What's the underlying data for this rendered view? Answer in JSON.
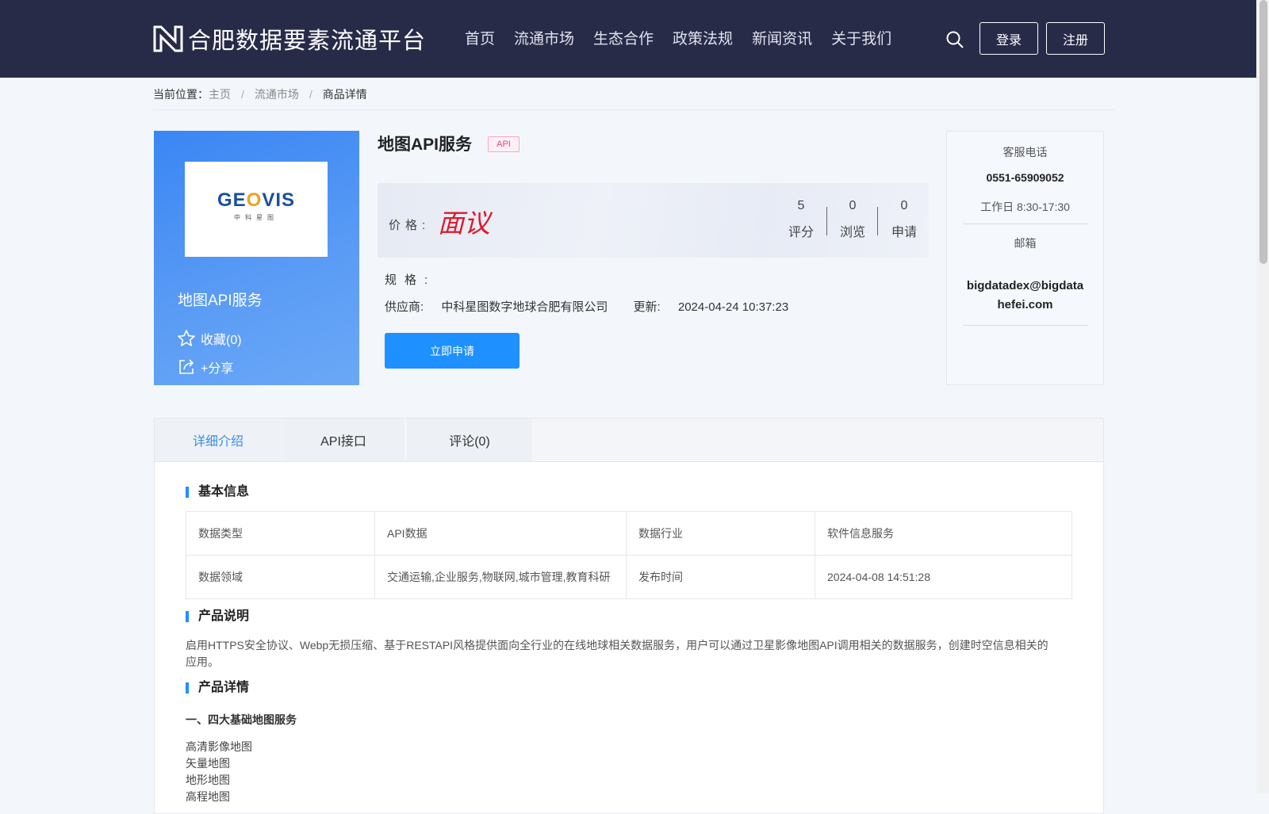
{
  "header": {
    "brand": "合肥数据要素流通平台",
    "nav": [
      "首页",
      "流通市场",
      "生态合作",
      "政策法规",
      "新闻资讯",
      "关于我们"
    ],
    "login": "登录",
    "register": "注册"
  },
  "breadcrumb": {
    "label": "当前位置：",
    "items": [
      "主页",
      "流通市场",
      "商品详情"
    ]
  },
  "product": {
    "logo_text_a": "GE",
    "logo_text_o": "O",
    "logo_text_b": "VIS",
    "logo_sub": "中科星图",
    "name": "地图API服务",
    "tag": "API",
    "favorite": "收藏(0)",
    "share": "+分享",
    "price_label": "价格:",
    "price_value": "面议",
    "stats": [
      {
        "value": "5",
        "label": "评分"
      },
      {
        "value": "0",
        "label": "浏览"
      },
      {
        "value": "0",
        "label": "申请"
      }
    ],
    "spec_label": "规格:",
    "supplier_label": "供应商:",
    "supplier": "中科星图数字地球合肥有限公司",
    "update_label": "更新:",
    "update_time": "2024-04-24 10:37:23",
    "apply": "立即申请"
  },
  "service": {
    "phone_title": "客服电话",
    "phone": "0551-65909052",
    "hours": "工作日 8:30-17:30",
    "email_title": "邮箱",
    "email_line1": "bigdatadex@bigdata",
    "email_line2": "hefei.com"
  },
  "tabs": [
    "详细介绍",
    "API接口",
    "评论(0)"
  ],
  "basic_info": {
    "title": "基本信息",
    "rows": [
      [
        "数据类型",
        "API数据",
        "数据行业",
        "软件信息服务"
      ],
      [
        "数据领域",
        "交通运输,企业服务,物联网,城市管理,教育科研",
        "发布时间",
        "2024-04-08 14:51:28"
      ]
    ]
  },
  "description": {
    "title": "产品说明",
    "text": "启用HTTPS安全协议、Webp无损压缩、基于RESTAPI风格提供面向全行业的在线地球相关数据服务，用户可以通过卫星影像地图API调用相关的数据服务，创建时空信息相关的应用。"
  },
  "details": {
    "title": "产品详情",
    "subtitle": "一、四大基础地图服务",
    "items": [
      "高清影像地图",
      "矢量地图",
      "地形地图",
      "高程地图"
    ]
  }
}
